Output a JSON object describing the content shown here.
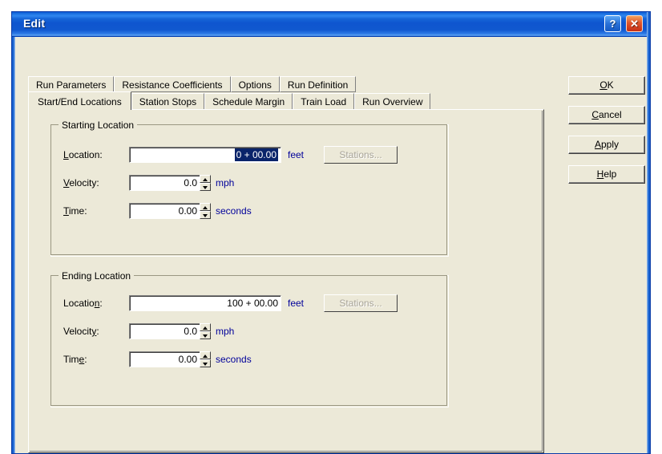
{
  "window": {
    "title": "Edit",
    "help_button": "?",
    "close_button": "✕",
    "titlebar_color": "#0f55cf",
    "dialog_bg": "#ece9d8"
  },
  "tabs": {
    "row1": [
      {
        "label": "Run Parameters",
        "selected": false
      },
      {
        "label": "Resistance Coefficients",
        "selected": false
      },
      {
        "label": "Options",
        "selected": false
      },
      {
        "label": "Run Definition",
        "selected": false
      }
    ],
    "row2": [
      {
        "label": "Start/End Locations",
        "selected": true
      },
      {
        "label": "Station Stops",
        "selected": false
      },
      {
        "label": "Schedule Margin",
        "selected": false
      },
      {
        "label": "Train Load",
        "selected": false
      },
      {
        "label": "Run Overview",
        "selected": false
      }
    ]
  },
  "starting_location": {
    "legend": "Starting Location",
    "location": {
      "label_pre": "",
      "label_accel": "L",
      "label_post": "ocation:",
      "value": "0 + 00.00",
      "selected": true,
      "unit": "feet",
      "button": "Stations...",
      "button_enabled": false
    },
    "velocity": {
      "label_pre": "",
      "label_accel": "V",
      "label_post": "elocity:",
      "value": "0.0",
      "unit": "mph"
    },
    "time": {
      "label_pre": "",
      "label_accel": "T",
      "label_post": "ime:",
      "value": "0.00",
      "unit": "seconds"
    }
  },
  "ending_location": {
    "legend": "Ending Location",
    "location": {
      "label_pre": "Locatio",
      "label_accel": "n",
      "label_post": ":",
      "value": "100 + 00.00",
      "selected": false,
      "unit": "feet",
      "button": "Stations...",
      "button_enabled": false
    },
    "velocity": {
      "label_pre": "Velocit",
      "label_accel": "y",
      "label_post": ":",
      "value": "0.0",
      "unit": "mph"
    },
    "time": {
      "label_pre": "Tim",
      "label_accel": "e",
      "label_post": ":",
      "value": "0.00",
      "unit": "seconds"
    }
  },
  "commands": [
    {
      "pre": "",
      "accel": "O",
      "post": "K"
    },
    {
      "pre": "",
      "accel": "C",
      "post": "ancel"
    },
    {
      "pre": "",
      "accel": "A",
      "post": "pply"
    },
    {
      "pre": "",
      "accel": "H",
      "post": "elp"
    }
  ]
}
